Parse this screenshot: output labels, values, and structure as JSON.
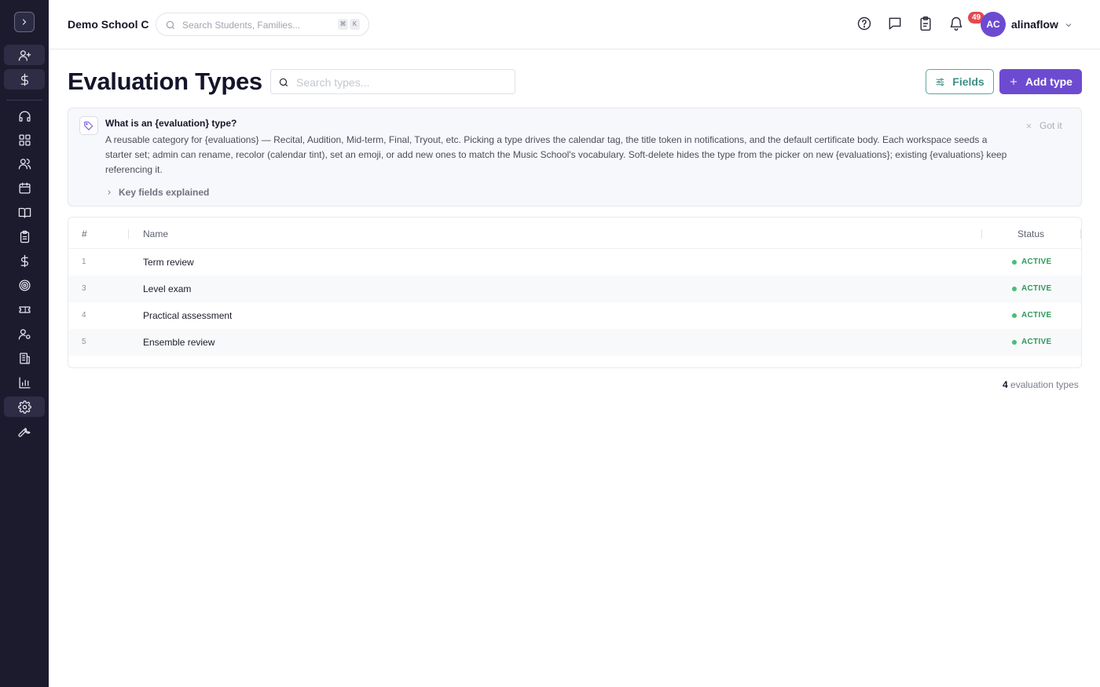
{
  "header": {
    "school_name": "Demo School C",
    "search_placeholder": "Search Students, Families...",
    "shortcut_keys": [
      "⌘",
      "K"
    ],
    "tasks_badge": "49",
    "user_initials": "AC",
    "user_name": "alinaflow"
  },
  "page": {
    "title": "Evaluation Types",
    "search_placeholder": "Search types...",
    "fields_button": "Fields",
    "add_button": "Add type"
  },
  "info": {
    "title": "What is an {evaluation} type?",
    "body": "A reusable category for {evaluations} — Recital, Audition, Mid-term, Final, Tryout, etc. Picking a type drives the calendar tag, the title token in notifications, and the default certificate body. Each workspace seeds a starter set; admin can rename, recolor (calendar tint), set an emoji, or add new ones to match the Music School's vocabulary. Soft-delete hides the type from the picker on new {evaluations}; existing {evaluations} keep referencing it.",
    "key_fields_toggle": "Key fields explained",
    "dismiss": "Got it"
  },
  "table": {
    "columns": [
      "#",
      "Name",
      "Status"
    ],
    "rows": [
      {
        "num": "1",
        "name": "Term review",
        "status": "ACTIVE"
      },
      {
        "num": "3",
        "name": "Level exam",
        "status": "ACTIVE"
      },
      {
        "num": "4",
        "name": "Practical assessment",
        "status": "ACTIVE"
      },
      {
        "num": "5",
        "name": "Ensemble review",
        "status": "ACTIVE"
      }
    ]
  },
  "footer": {
    "count": "4",
    "count_label": "evaluation types"
  },
  "colors": {
    "sidebar_bg": "#1c1b2e",
    "accent": "#6d4bd1",
    "teal": "#3d8e88",
    "active_green": "#2f9a5b",
    "badge_red": "#e5484d"
  },
  "sidebar": {
    "icons": [
      "expand-sidebar-icon",
      "add-user-icon",
      "dollar-icon",
      "headset-icon",
      "dashboard-icon",
      "users-icon",
      "calendar-icon",
      "book-icon",
      "clipboard-icon",
      "billing-dollar-icon",
      "target-icon",
      "ticket-icon",
      "user-settings-icon",
      "building-icon",
      "bar-chart-icon",
      "gear-icon",
      "wrench-icon"
    ]
  }
}
